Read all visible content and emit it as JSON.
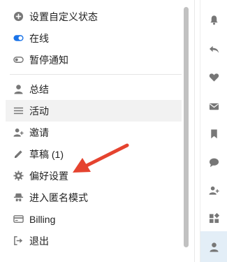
{
  "menu": {
    "items": [
      {
        "label": "设置自定义状态",
        "icon": "plus-circle-icon"
      },
      {
        "label": "在线",
        "icon": "toggle-on-icon"
      },
      {
        "label": "暂停通知",
        "icon": "toggle-off-icon"
      },
      {
        "label": "总结",
        "icon": "user-icon"
      },
      {
        "label": "活动",
        "icon": "bars-icon"
      },
      {
        "label": "邀请",
        "icon": "user-plus-icon"
      },
      {
        "label": "草稿 (1)",
        "icon": "pencil-icon"
      },
      {
        "label": "偏好设置",
        "icon": "gear-icon"
      },
      {
        "label": "进入匿名模式",
        "icon": "incognito-icon"
      },
      {
        "label": "Billing",
        "icon": "credit-card-icon"
      },
      {
        "label": "退出",
        "icon": "sign-out-icon"
      }
    ]
  },
  "rail": {
    "buttons": [
      {
        "icon": "bell-icon"
      },
      {
        "icon": "reply-icon"
      },
      {
        "icon": "heart-icon"
      },
      {
        "icon": "envelope-icon"
      },
      {
        "icon": "bookmark-icon"
      },
      {
        "icon": "comment-icon"
      },
      {
        "icon": "user-plus-icon"
      },
      {
        "icon": "widgets-icon"
      },
      {
        "icon": "user-icon"
      }
    ]
  },
  "colors": {
    "icon_gray": "#8c8c8c",
    "toggle_blue": "#1a73e8",
    "arrow_red": "#e5432f",
    "active_row": "#f2f2f2",
    "selected_rail": "#e3eef7"
  }
}
